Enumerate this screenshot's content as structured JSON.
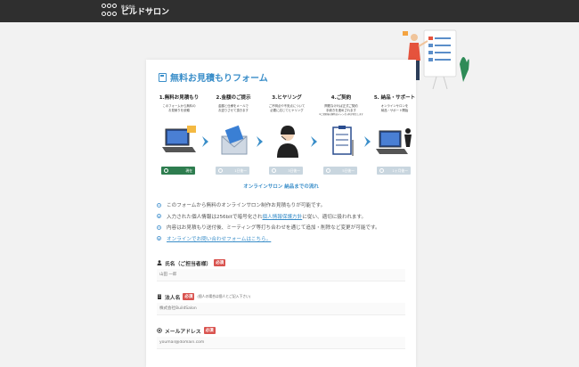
{
  "header": {
    "logo_small": "株式会社",
    "logo_name": "ビルドサロン"
  },
  "form": {
    "title": "無料お見積もりフォーム",
    "steps": [
      {
        "title": "1.無料お見積もり",
        "desc1": "このフォームから無料の",
        "desc2": "お見積りを依頼",
        "badge": "現在"
      },
      {
        "title": "2.金額のご提示",
        "desc1": "金額と仕様をメールで",
        "desc2": "お送りさせて頂きます",
        "badge": "1日後〜"
      },
      {
        "title": "3.ヒヤリング",
        "desc1": "ご不明点や不安点について",
        "desc2": "必要に応じてヒヤリング",
        "badge": "3日後〜"
      },
      {
        "title": "4.ご契約",
        "desc1": "問題なければ正式ご契約",
        "desc2": "手続きを進めされます",
        "desc3": "※ご契約後の解約はキャンセル料が発生します",
        "badge": "5日後〜"
      },
      {
        "title": "5. 納品・サポート",
        "desc1": "オンラインサロンを",
        "desc2": "納品・サポート開始",
        "badge": "1ヶ月後〜"
      }
    ],
    "flow_caption": "オンラインサロン 納品までの流れ",
    "notes": [
      {
        "pre": "このフォームから無料のオンラインサロン制作お見積もりが可能です。",
        "link": "",
        "post": ""
      },
      {
        "pre": "入力された個人情報は256bitで暗号化され",
        "link": "個人情報保護方針",
        "post": "に従い、適切に扱われます。"
      },
      {
        "pre": "内容はお見積もり送付後、ミーティング等打ち合わせを通じて追加・削除など変更が可能です。",
        "link": "",
        "post": ""
      },
      {
        "pre": "",
        "link": "オンラインでお問い合わせフォームはこちら。",
        "post": ""
      }
    ],
    "fields": {
      "name": {
        "label": "氏名（ご担当者様）",
        "required": "必須",
        "placeholder": "山田 一郎"
      },
      "company": {
        "label": "法人名",
        "required": "必須",
        "hint": "個人の場合は個人とご記入下さい",
        "placeholder": "株式会社BuildSalon"
      },
      "email": {
        "label": "メールアドレス",
        "required": "必須",
        "placeholder": "youmail@domain.com"
      }
    }
  },
  "colors": {
    "accent": "#3a8ec9",
    "required": "#d9534f",
    "active_badge": "#2e7d4f",
    "topbar": "#2f2f2f"
  }
}
